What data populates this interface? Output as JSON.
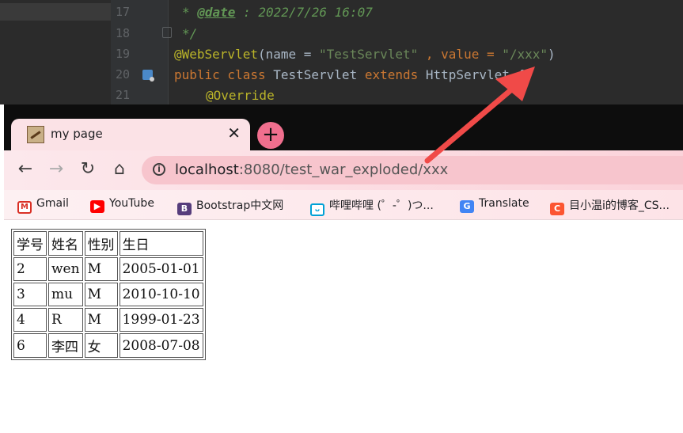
{
  "ide": {
    "line_numbers": [
      "17",
      "18",
      "19",
      "20",
      "21"
    ],
    "lines": {
      "l17": {
        "prefix": "* ",
        "tag": "@date",
        "rest": " : 2022/7/26 16:07"
      },
      "l18": {
        "text": "*/"
      },
      "l19": {
        "anno": "@WebServlet",
        "p1": "(name = ",
        "s1": "\"TestServlet\"",
        "p2": " , value = ",
        "s2": "\"/xxx\"",
        "p3": ")"
      },
      "l20": {
        "kw1": "public class ",
        "name": "TestServlet ",
        "kw2": "extends ",
        "parent": "HttpServlet ",
        "brace": "{"
      },
      "l21": {
        "anno": "@Override"
      }
    }
  },
  "browser": {
    "tab": {
      "title": "my page",
      "close": "✕"
    },
    "new_tab": "+",
    "nav": {
      "back": "←",
      "forward": "→",
      "reload": "↻",
      "home": "⌂"
    },
    "address": {
      "host": "localhost",
      "rest": ":8080/test_war_exploded/xxx"
    },
    "bookmarks": [
      {
        "icon": "gmail-icon",
        "glyph": "M",
        "label": "Gmail"
      },
      {
        "icon": "youtube-icon",
        "glyph": "▶",
        "label": "YouTube"
      },
      {
        "icon": "bootstrap-icon",
        "glyph": "B",
        "label": "Bootstrap中文网"
      },
      {
        "icon": "bilibili-icon",
        "glyph": "ᴗ",
        "label": "哔哩哔哩 (゜-゜)つ..."
      },
      {
        "icon": "translate-icon",
        "glyph": "G",
        "label": "Translate"
      },
      {
        "icon": "csdn-icon",
        "glyph": "C",
        "label": "目小温i的博客_CS..."
      }
    ]
  },
  "table": {
    "header": [
      "学号",
      "姓名",
      "性别",
      "生日"
    ],
    "rows": [
      [
        "2",
        "wen",
        "M",
        "2005-01-01"
      ],
      [
        "3",
        "mu",
        "M",
        "2010-10-10"
      ],
      [
        "4",
        "R",
        "M",
        "1999-01-23"
      ],
      [
        "6",
        "李四",
        "女",
        "2008-07-08"
      ]
    ]
  },
  "colors": {
    "arrow": "#f04a48",
    "tab_bg": "#fbe2e6",
    "omnibox": "#f7c5cd",
    "new_tab": "#f06f8e"
  }
}
